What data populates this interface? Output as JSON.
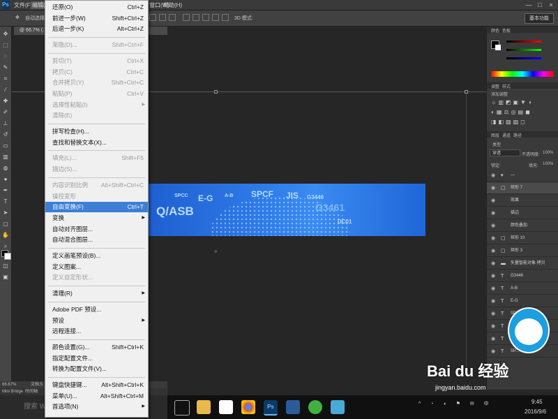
{
  "app": {
    "logo": "Ps"
  },
  "menubar": {
    "items": [
      "文件(F)",
      "编辑(E)",
      "图像(I)",
      "图层(L)",
      "文字(Y)",
      "选择(S)",
      "滤镜(T)",
      "3D(D)",
      "视图(V)",
      "窗口(W)",
      "帮助(H)"
    ],
    "window_controls": [
      "—",
      "□",
      "×"
    ]
  },
  "options_bar": {
    "auto_select": "自动选择",
    "workspace": "基本功能"
  },
  "document_tab": {
    "label": "@ 66.7% (...)"
  },
  "edit_menu": {
    "items": [
      {
        "label": "还原(O)",
        "shortcut": "Ctrl+Z",
        "disabled": false
      },
      {
        "label": "前进一步(W)",
        "shortcut": "Shift+Ctrl+Z",
        "disabled": false
      },
      {
        "label": "后退一步(K)",
        "shortcut": "Alt+Ctrl+Z",
        "disabled": false
      },
      {
        "sep": true
      },
      {
        "label": "渐隐(D)...",
        "shortcut": "Shift+Ctrl+F",
        "disabled": true
      },
      {
        "sep": true
      },
      {
        "label": "剪切(T)",
        "shortcut": "Ctrl+X",
        "disabled": true
      },
      {
        "label": "拷贝(C)",
        "shortcut": "Ctrl+C",
        "disabled": true
      },
      {
        "label": "合并拷贝(Y)",
        "shortcut": "Shift+Ctrl+C",
        "disabled": true
      },
      {
        "label": "粘贴(P)",
        "shortcut": "Ctrl+V",
        "disabled": true
      },
      {
        "label": "选择性粘贴(I)",
        "shortcut": "",
        "disabled": true,
        "submenu": true
      },
      {
        "label": "清除(E)",
        "shortcut": "",
        "disabled": true
      },
      {
        "sep": true
      },
      {
        "label": "拼写检查(H)...",
        "shortcut": "",
        "disabled": false
      },
      {
        "label": "查找和替换文本(X)...",
        "shortcut": "",
        "disabled": false
      },
      {
        "sep": true
      },
      {
        "label": "填充(L)...",
        "shortcut": "Shift+F5",
        "disabled": true
      },
      {
        "label": "描边(S)...",
        "shortcut": "",
        "disabled": true
      },
      {
        "sep": true
      },
      {
        "label": "内容识别比例",
        "shortcut": "Alt+Shift+Ctrl+C",
        "disabled": true
      },
      {
        "label": "操控变形",
        "shortcut": "",
        "disabled": true
      },
      {
        "label": "自由变换(F)",
        "shortcut": "Ctrl+T",
        "disabled": false,
        "active": true
      },
      {
        "label": "变换",
        "shortcut": "",
        "disabled": false,
        "submenu": true
      },
      {
        "label": "自动对齐图层...",
        "shortcut": "",
        "disabled": false
      },
      {
        "label": "自动混合图层...",
        "shortcut": "",
        "disabled": false
      },
      {
        "sep": true
      },
      {
        "label": "定义画笔预设(B)...",
        "shortcut": "",
        "disabled": false
      },
      {
        "label": "定义图案...",
        "shortcut": "",
        "disabled": false
      },
      {
        "label": "定义自定形状...",
        "shortcut": "",
        "disabled": true
      },
      {
        "sep": true
      },
      {
        "label": "清理(R)",
        "shortcut": "",
        "disabled": false,
        "submenu": true
      },
      {
        "sep": true
      },
      {
        "label": "Adobe PDF 预设...",
        "shortcut": "",
        "disabled": false
      },
      {
        "label": "预设",
        "shortcut": "",
        "disabled": false,
        "submenu": true
      },
      {
        "label": "远程连接...",
        "shortcut": "",
        "disabled": false
      },
      {
        "sep": true
      },
      {
        "label": "颜色设置(G)...",
        "shortcut": "Shift+Ctrl+K",
        "disabled": false
      },
      {
        "label": "指定配置文件...",
        "shortcut": "",
        "disabled": false
      },
      {
        "label": "转换为配置文件(V)...",
        "shortcut": "",
        "disabled": false
      },
      {
        "sep": true
      },
      {
        "label": "键盘快捷键...",
        "shortcut": "Alt+Shift+Ctrl+K",
        "disabled": false
      },
      {
        "label": "菜单(U)...",
        "shortcut": "Alt+Shift+Ctrl+M",
        "disabled": false
      },
      {
        "label": "首选项(N)",
        "shortcut": "",
        "disabled": false,
        "submenu": true
      }
    ]
  },
  "banner": {
    "texts": [
      "SPCC",
      "E-G",
      "A-B",
      "SPCF",
      "JIS",
      "G3446",
      "Q/ASB",
      "G3461",
      "DC01"
    ]
  },
  "panels": {
    "color_tabs": [
      "颜色",
      "色板"
    ],
    "adjust_tabs": [
      "调整",
      "样式"
    ],
    "adjust_title": "添加调整",
    "layers_tabs": [
      "图层",
      "通道",
      "路径"
    ],
    "kind_label": "类型",
    "blend_mode": "穿透",
    "opacity_label": "不透明度:",
    "opacity_value": "100%",
    "lock_label": "锁定:",
    "fill_label": "填充:",
    "fill_value": "100%",
    "layers": [
      {
        "kind": "▾",
        "name": "—"
      },
      {
        "kind": "▢",
        "name": "矩形 7"
      },
      {
        "kind": "",
        "name": "效果"
      },
      {
        "kind": "",
        "name": "描边"
      },
      {
        "kind": "",
        "name": "颜色叠加"
      },
      {
        "kind": "▢",
        "name": "矩形 10"
      },
      {
        "kind": "▢",
        "name": "矩形 3"
      },
      {
        "kind": "▬",
        "name": "矢量智能对象 拷贝"
      },
      {
        "kind": "T",
        "name": "G3446"
      },
      {
        "kind": "T",
        "name": "A-B"
      },
      {
        "kind": "T",
        "name": "E-G"
      },
      {
        "kind": "T",
        "name": "SPCF"
      },
      {
        "kind": "T",
        "name": "DC01"
      },
      {
        "kind": "T",
        "name": "JIS"
      },
      {
        "kind": "T",
        "name": "SP..."
      }
    ]
  },
  "status": {
    "zoom": "66.67%",
    "doc": "文档:5",
    "bridge": "Mini Bridge",
    "timeline": "时间轴"
  },
  "taskbar": {
    "search": "搜索 W",
    "time": "9:45",
    "date": "2016/9/6"
  },
  "watermark": {
    "brand": "Bai du 经验",
    "url": "jingyan.baidu.com"
  },
  "colors": {
    "menu_highlight": "#3c7fd5",
    "banner_blue": "#2e7ae8"
  }
}
